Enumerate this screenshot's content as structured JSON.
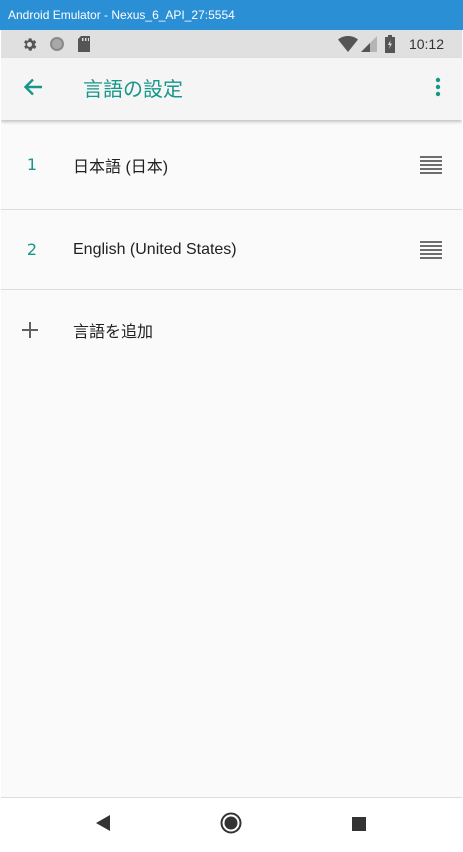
{
  "window": {
    "title": "Android Emulator - Nexus_6_API_27:5554"
  },
  "status_bar": {
    "time": "10:12",
    "left_icons": [
      "gear-icon",
      "circle-icon",
      "sd-card-icon"
    ],
    "right_icons": [
      "wifi-icon",
      "signal-icon",
      "battery-icon"
    ]
  },
  "app_bar": {
    "title": "言語の設定",
    "accent_color": "#17968a",
    "back_icon": "arrow-left-icon",
    "more_icon": "more-vert-icon"
  },
  "languages": [
    {
      "number": "1",
      "label": "日本語 (日本)"
    },
    {
      "number": "2",
      "label": "English (United States)"
    }
  ],
  "add_language": {
    "label": "言語を追加",
    "icon": "plus-icon"
  },
  "nav_bar": {
    "icons": [
      "back-triangle-icon",
      "home-circle-icon",
      "recents-square-icon"
    ]
  }
}
